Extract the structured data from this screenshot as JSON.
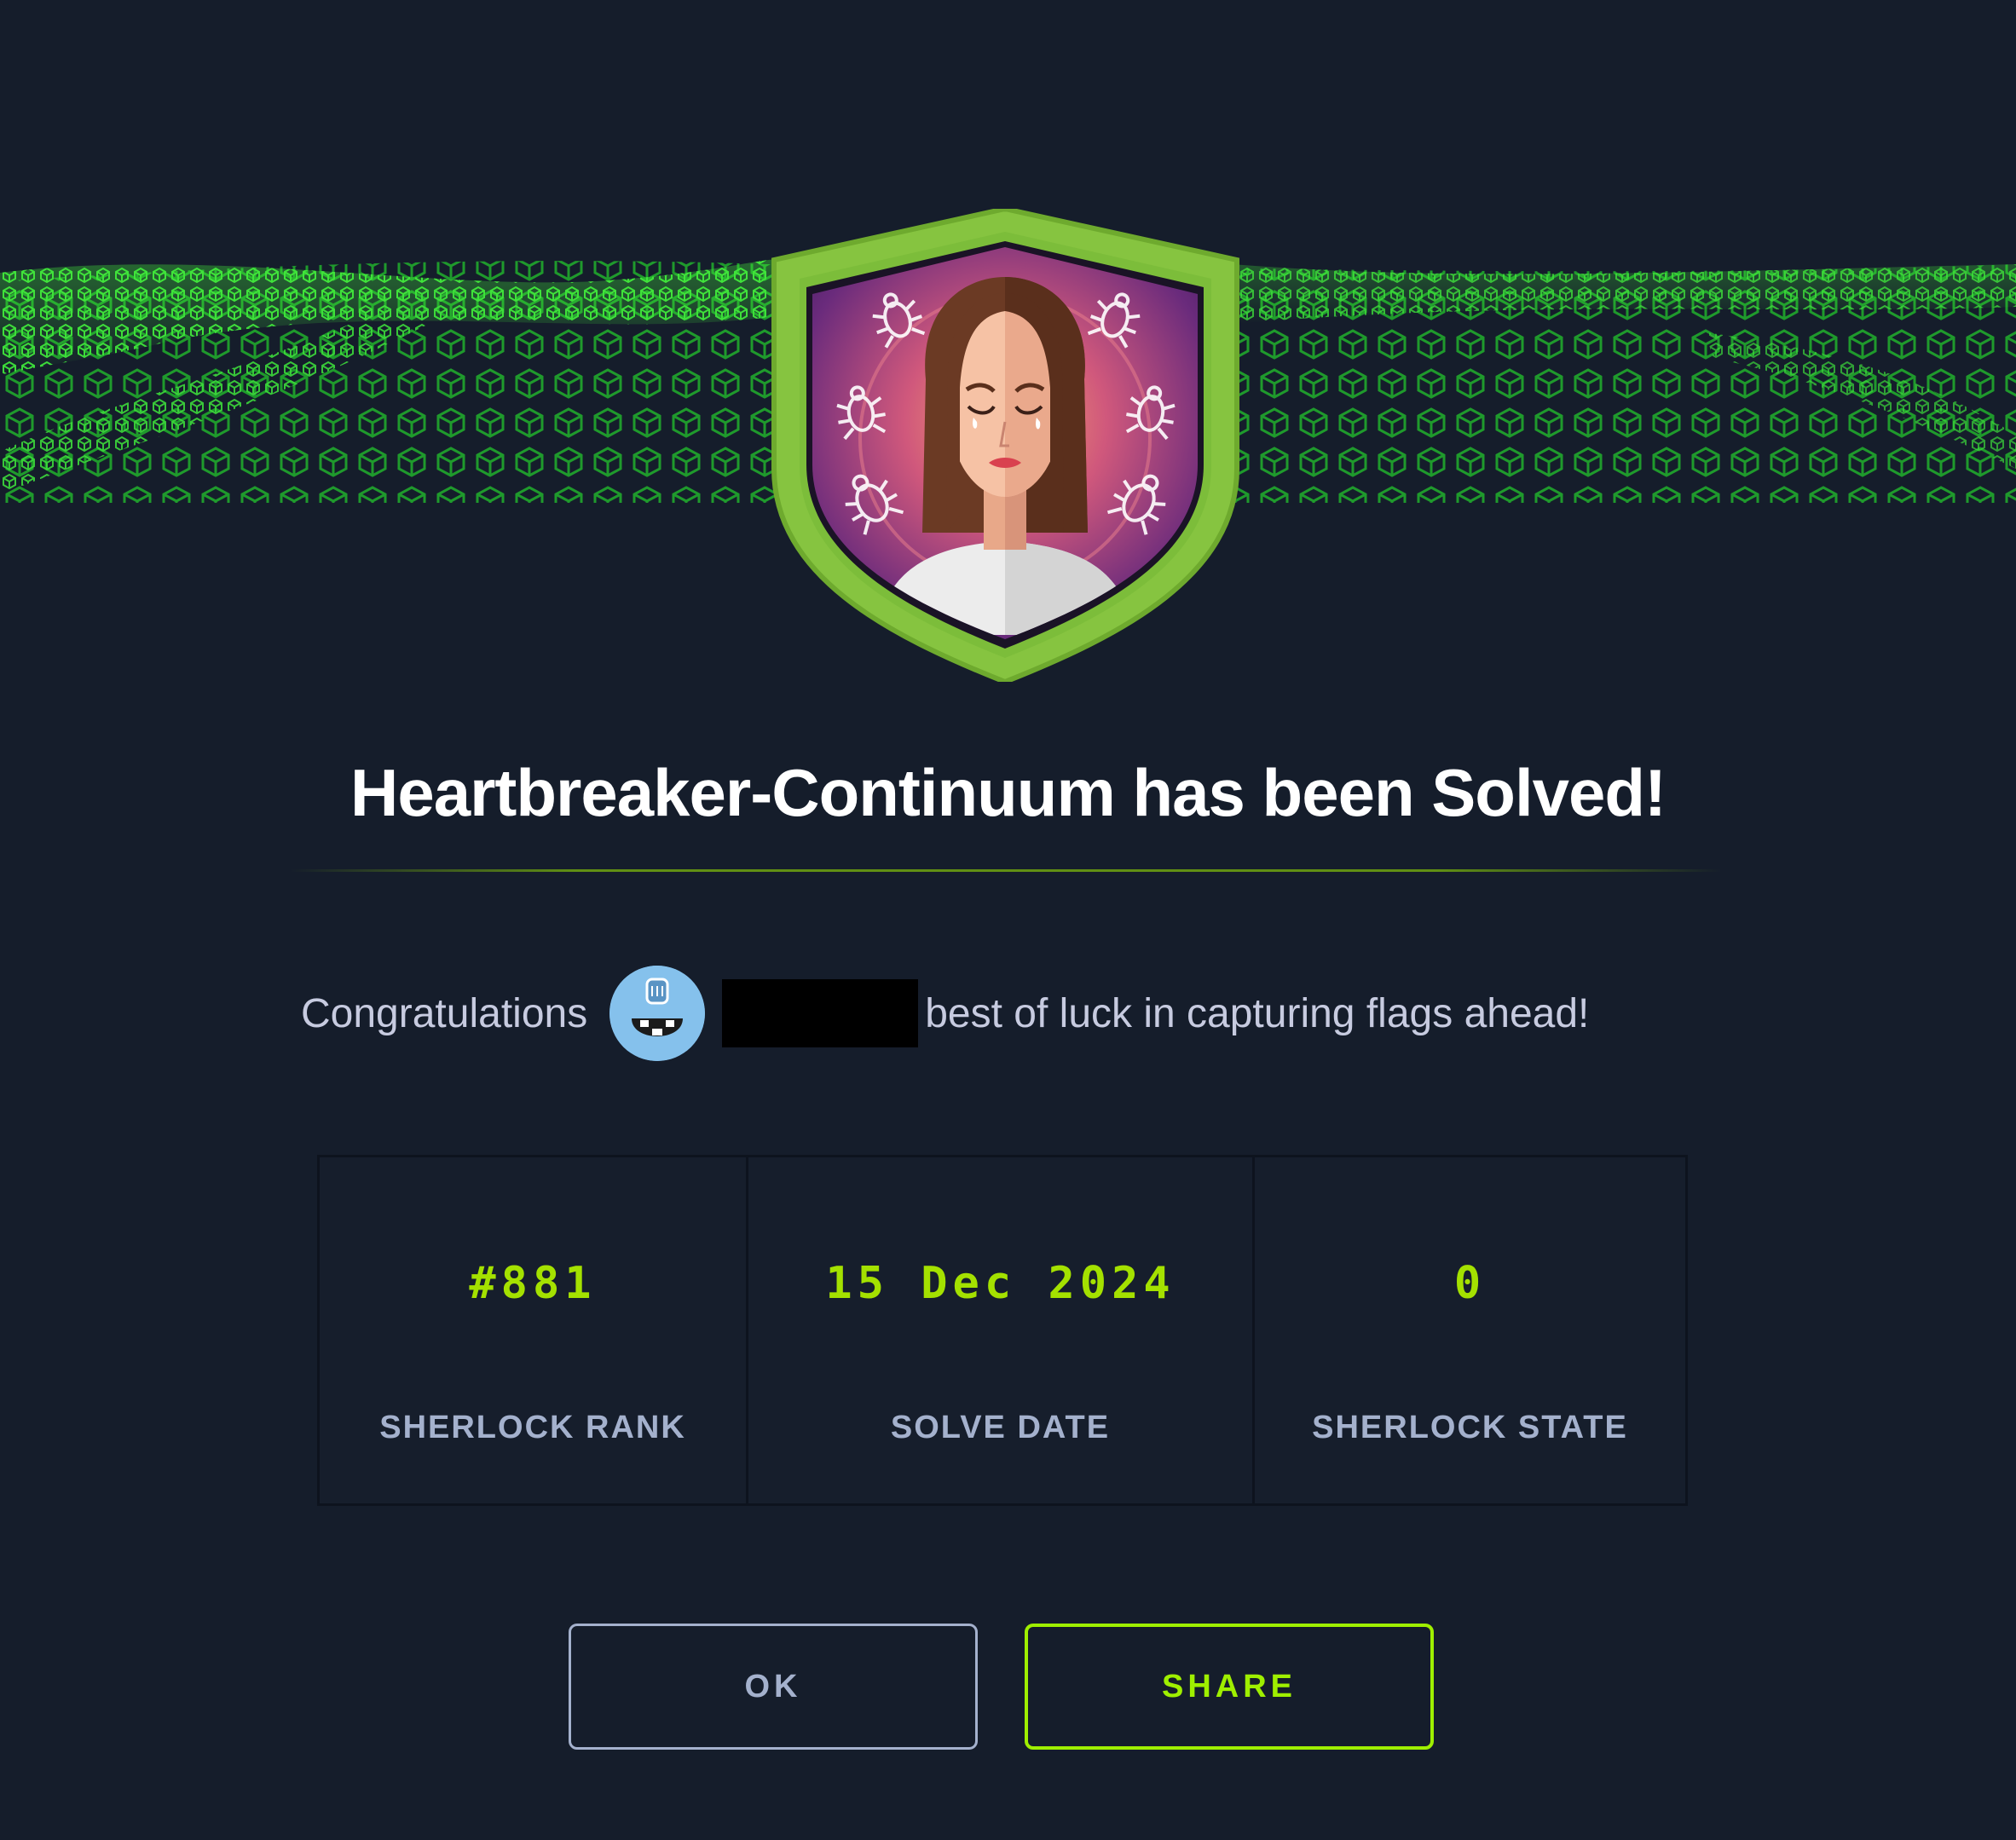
{
  "title": "Heartbreaker-Continuum has been Solved!",
  "congrats": {
    "prefix": "Congratulations",
    "suffix": "best of luck in capturing flags ahead!"
  },
  "stats": [
    {
      "value": "#881",
      "label": "SHERLOCK RANK"
    },
    {
      "value": "15 Dec 2024",
      "label": "SOLVE DATE"
    },
    {
      "value": "0",
      "label": "SHERLOCK STATE"
    }
  ],
  "buttons": {
    "ok": "OK",
    "share": "SHARE"
  },
  "colors": {
    "background": "#151d2b",
    "accent": "#9fef00",
    "stat_value": "#a4e100",
    "muted": "#a4b1cd",
    "badge_border": "#86c440"
  },
  "icons": {
    "badge": "crying-woman-badge-icon",
    "avatar": "user-avatar-icon",
    "bug": "bug-icon"
  }
}
